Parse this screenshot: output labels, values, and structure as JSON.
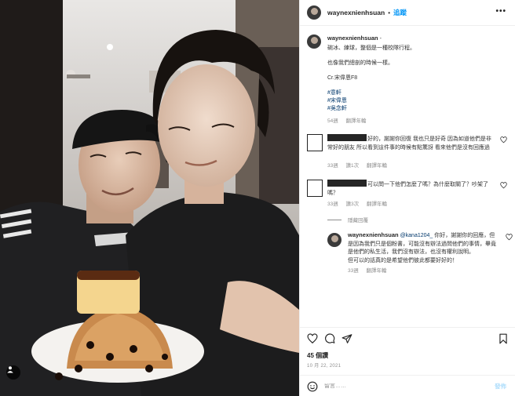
{
  "header": {
    "username": "waynexnienhsuan",
    "separator": "•",
    "follow_label": "追蹤",
    "more_label": "•••"
  },
  "caption": {
    "username": "waynexnienhsuan",
    "separator": "-",
    "lines": [
      "碗冰、練球，整個是一種校隊行程。",
      "也像我們總剖的時候一樣。",
      "Cr.宋偉恩F8"
    ],
    "tags": [
      "#意軒",
      "#宋偉恩",
      "#吳念軒"
    ],
    "time_ago": "54週",
    "see_translation": "翻譯年輪"
  },
  "comments": [
    {
      "text": "好的，謝謝你回復 我也只是好奇 因為如道他們是非常好的朋友 所以看到這件事的時候有點驚訝 看來他們是沒有回應過",
      "time_ago": "33週",
      "likes": "讚1次",
      "reply_label": "翻譯年輪"
    },
    {
      "text": "可以問一下他們怎麼了嗎？為什麼取關了？吵架了嗎？",
      "time_ago": "33週",
      "likes": "讚3次",
      "reply_label": "翻譯年輪"
    }
  ],
  "view_replies_label": "隱藏回覆",
  "reply": {
    "username": "waynexnienhsuan",
    "mention": "@kana1204_",
    "text": "你好，謝謝你的回應，但是因為我們只是個粉書，可能沒有辦法過問他們的事情，畢竟是他們的私生活，我們沒有辦法，也沒有權利說明。\n但可以的話真的是希望他們彼此都要好好的！",
    "time_ago": "33週",
    "reply_label": "翻譯年輪"
  },
  "actions": {
    "likes": "45 個讚",
    "date": "10 月 22, 2021"
  },
  "add_comment": {
    "placeholder": "留言……",
    "post_label": "發佈"
  },
  "colors": {
    "accent": "#0095f6",
    "link": "#00376b",
    "muted": "#8e8e8e",
    "text": "#262626"
  }
}
